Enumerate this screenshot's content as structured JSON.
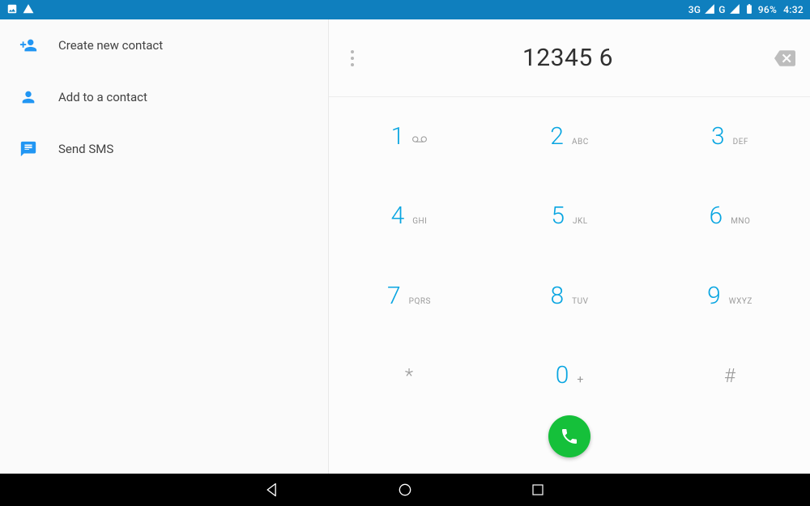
{
  "status": {
    "network_label_1": "3G",
    "network_label_2": "G",
    "battery_pct": "96%",
    "clock": "4:32"
  },
  "left": {
    "create_label": "Create new contact",
    "add_label": "Add to a contact",
    "sms_label": "Send SMS"
  },
  "dialer": {
    "entered": "12345 6",
    "keys": {
      "k1": {
        "digit": "1",
        "letters": ""
      },
      "k2": {
        "digit": "2",
        "letters": "ABC"
      },
      "k3": {
        "digit": "3",
        "letters": "DEF"
      },
      "k4": {
        "digit": "4",
        "letters": "GHI"
      },
      "k5": {
        "digit": "5",
        "letters": "JKL"
      },
      "k6": {
        "digit": "6",
        "letters": "MNO"
      },
      "k7": {
        "digit": "7",
        "letters": "PQRS"
      },
      "k8": {
        "digit": "8",
        "letters": "TUV"
      },
      "k9": {
        "digit": "9",
        "letters": "WXYZ"
      },
      "kstar": {
        "digit": "*"
      },
      "k0": {
        "digit": "0",
        "letters": "+"
      },
      "khash": {
        "digit": "#"
      }
    }
  }
}
